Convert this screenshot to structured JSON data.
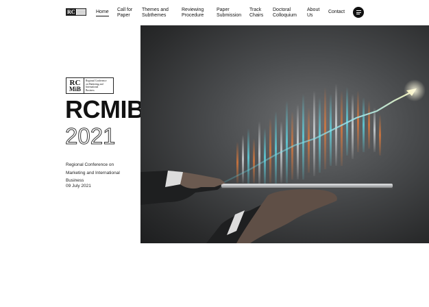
{
  "nav": {
    "logo_text": "RC",
    "items": [
      {
        "label": "Home"
      },
      {
        "label": "Call for\nPaper"
      },
      {
        "label": "Themes and\nSubthemes"
      },
      {
        "label": "Reviewing\nProcedure"
      },
      {
        "label": "Paper\nSubmission"
      },
      {
        "label": "Track\nChairs"
      },
      {
        "label": "Doctoral\nColloquium"
      },
      {
        "label": "About\nUs"
      },
      {
        "label": "Contact"
      }
    ]
  },
  "hero": {
    "logo_mark_top": "RC",
    "logo_mark_bottom": "MiB",
    "logo_words": "Regional Conference\non Marketing and\nInternational\nBusiness",
    "title": "RCMIB",
    "year": "2021",
    "description": "Regional Conference on Marketing and International Business",
    "date": "09 July 2021"
  },
  "colors": {
    "accent": "#111111",
    "chart_teal": "#5fd3e0",
    "chart_orange": "#e07a3a",
    "arrow": "#f3efb6"
  },
  "icons": {
    "menu": "hamburger-icon"
  }
}
